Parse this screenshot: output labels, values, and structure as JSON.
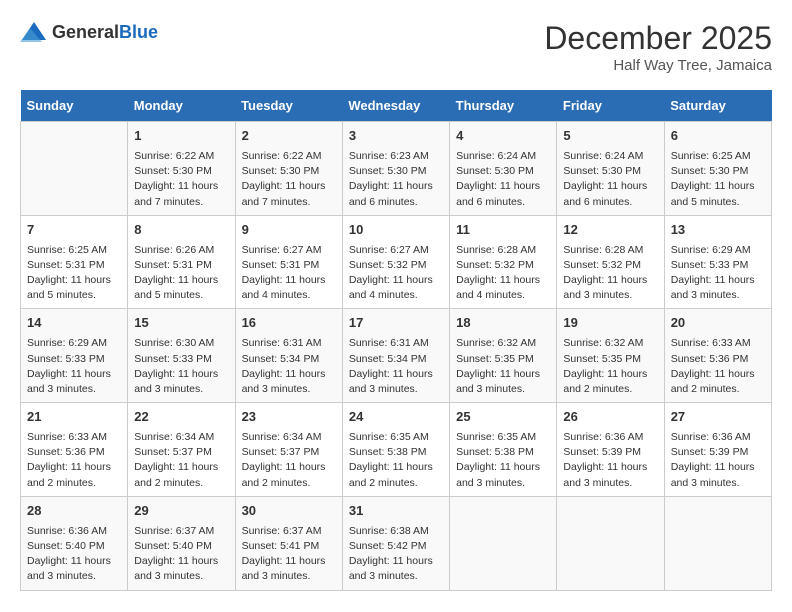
{
  "logo": {
    "general": "General",
    "blue": "Blue"
  },
  "title": "December 2025",
  "subtitle": "Half Way Tree, Jamaica",
  "days_header": [
    "Sunday",
    "Monday",
    "Tuesday",
    "Wednesday",
    "Thursday",
    "Friday",
    "Saturday"
  ],
  "weeks": [
    [
      {
        "day": "",
        "info": ""
      },
      {
        "day": "1",
        "info": "Sunrise: 6:22 AM\nSunset: 5:30 PM\nDaylight: 11 hours\nand 7 minutes."
      },
      {
        "day": "2",
        "info": "Sunrise: 6:22 AM\nSunset: 5:30 PM\nDaylight: 11 hours\nand 7 minutes."
      },
      {
        "day": "3",
        "info": "Sunrise: 6:23 AM\nSunset: 5:30 PM\nDaylight: 11 hours\nand 6 minutes."
      },
      {
        "day": "4",
        "info": "Sunrise: 6:24 AM\nSunset: 5:30 PM\nDaylight: 11 hours\nand 6 minutes."
      },
      {
        "day": "5",
        "info": "Sunrise: 6:24 AM\nSunset: 5:30 PM\nDaylight: 11 hours\nand 6 minutes."
      },
      {
        "day": "6",
        "info": "Sunrise: 6:25 AM\nSunset: 5:30 PM\nDaylight: 11 hours\nand 5 minutes."
      }
    ],
    [
      {
        "day": "7",
        "info": "Sunrise: 6:25 AM\nSunset: 5:31 PM\nDaylight: 11 hours\nand 5 minutes."
      },
      {
        "day": "8",
        "info": "Sunrise: 6:26 AM\nSunset: 5:31 PM\nDaylight: 11 hours\nand 5 minutes."
      },
      {
        "day": "9",
        "info": "Sunrise: 6:27 AM\nSunset: 5:31 PM\nDaylight: 11 hours\nand 4 minutes."
      },
      {
        "day": "10",
        "info": "Sunrise: 6:27 AM\nSunset: 5:32 PM\nDaylight: 11 hours\nand 4 minutes."
      },
      {
        "day": "11",
        "info": "Sunrise: 6:28 AM\nSunset: 5:32 PM\nDaylight: 11 hours\nand 4 minutes."
      },
      {
        "day": "12",
        "info": "Sunrise: 6:28 AM\nSunset: 5:32 PM\nDaylight: 11 hours\nand 3 minutes."
      },
      {
        "day": "13",
        "info": "Sunrise: 6:29 AM\nSunset: 5:33 PM\nDaylight: 11 hours\nand 3 minutes."
      }
    ],
    [
      {
        "day": "14",
        "info": "Sunrise: 6:29 AM\nSunset: 5:33 PM\nDaylight: 11 hours\nand 3 minutes."
      },
      {
        "day": "15",
        "info": "Sunrise: 6:30 AM\nSunset: 5:33 PM\nDaylight: 11 hours\nand 3 minutes."
      },
      {
        "day": "16",
        "info": "Sunrise: 6:31 AM\nSunset: 5:34 PM\nDaylight: 11 hours\nand 3 minutes."
      },
      {
        "day": "17",
        "info": "Sunrise: 6:31 AM\nSunset: 5:34 PM\nDaylight: 11 hours\nand 3 minutes."
      },
      {
        "day": "18",
        "info": "Sunrise: 6:32 AM\nSunset: 5:35 PM\nDaylight: 11 hours\nand 3 minutes."
      },
      {
        "day": "19",
        "info": "Sunrise: 6:32 AM\nSunset: 5:35 PM\nDaylight: 11 hours\nand 2 minutes."
      },
      {
        "day": "20",
        "info": "Sunrise: 6:33 AM\nSunset: 5:36 PM\nDaylight: 11 hours\nand 2 minutes."
      }
    ],
    [
      {
        "day": "21",
        "info": "Sunrise: 6:33 AM\nSunset: 5:36 PM\nDaylight: 11 hours\nand 2 minutes."
      },
      {
        "day": "22",
        "info": "Sunrise: 6:34 AM\nSunset: 5:37 PM\nDaylight: 11 hours\nand 2 minutes."
      },
      {
        "day": "23",
        "info": "Sunrise: 6:34 AM\nSunset: 5:37 PM\nDaylight: 11 hours\nand 2 minutes."
      },
      {
        "day": "24",
        "info": "Sunrise: 6:35 AM\nSunset: 5:38 PM\nDaylight: 11 hours\nand 2 minutes."
      },
      {
        "day": "25",
        "info": "Sunrise: 6:35 AM\nSunset: 5:38 PM\nDaylight: 11 hours\nand 3 minutes."
      },
      {
        "day": "26",
        "info": "Sunrise: 6:36 AM\nSunset: 5:39 PM\nDaylight: 11 hours\nand 3 minutes."
      },
      {
        "day": "27",
        "info": "Sunrise: 6:36 AM\nSunset: 5:39 PM\nDaylight: 11 hours\nand 3 minutes."
      }
    ],
    [
      {
        "day": "28",
        "info": "Sunrise: 6:36 AM\nSunset: 5:40 PM\nDaylight: 11 hours\nand 3 minutes."
      },
      {
        "day": "29",
        "info": "Sunrise: 6:37 AM\nSunset: 5:40 PM\nDaylight: 11 hours\nand 3 minutes."
      },
      {
        "day": "30",
        "info": "Sunrise: 6:37 AM\nSunset: 5:41 PM\nDaylight: 11 hours\nand 3 minutes."
      },
      {
        "day": "31",
        "info": "Sunrise: 6:38 AM\nSunset: 5:42 PM\nDaylight: 11 hours\nand 3 minutes."
      },
      {
        "day": "",
        "info": ""
      },
      {
        "day": "",
        "info": ""
      },
      {
        "day": "",
        "info": ""
      }
    ]
  ]
}
